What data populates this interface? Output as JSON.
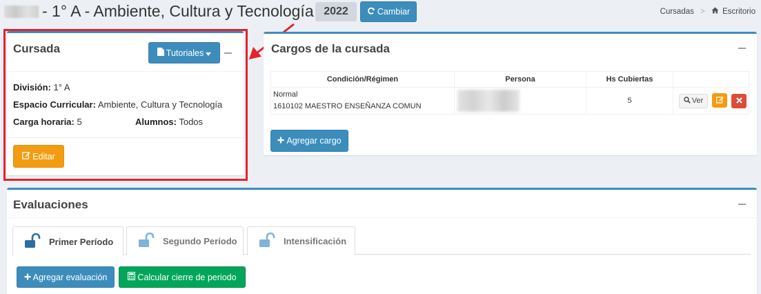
{
  "header": {
    "title": "- 1° A - Ambiente, Cultura y Tecnología -",
    "year": "2022",
    "cambiar_label": "Cambiar",
    "breadcrumb": {
      "item1": "Cursadas",
      "sep": ">",
      "item2": "Escritorio"
    }
  },
  "cursada": {
    "title": "Cursada",
    "tutoriales_label": "Tutoriales",
    "division_label": "División:",
    "division_value": "1° A",
    "espacio_label": "Espacio Curricular:",
    "espacio_value": "Ambiente, Cultura y Tecnología",
    "carga_label": "Carga horaria:",
    "carga_value": "5",
    "alumnos_label": "Alumnos:",
    "alumnos_value": "Todos",
    "editar_label": "Editar"
  },
  "cargos": {
    "title": "Cargos de la cursada",
    "columns": [
      "Condición/Régimen",
      "Persona",
      "Hs Cubiertas",
      ""
    ],
    "rows": [
      {
        "condicion": "Normal",
        "regimen": "1610102 MAESTRO ENSEÑANZA COMUN",
        "hs": "5",
        "ver_label": "Ver"
      }
    ],
    "agregar_label": "Agregar cargo"
  },
  "evaluaciones": {
    "title": "Evaluaciones",
    "tabs": [
      {
        "label": "Primer Período",
        "active": true
      },
      {
        "label": "Segundo Período",
        "active": false
      },
      {
        "label": "Intensificación",
        "active": false
      }
    ],
    "agregar_label": "Agregar evaluación",
    "calcular_label": "Calcular cierre de periodo"
  },
  "colors": {
    "primary": "#3c8dbc",
    "warning": "#f39c12",
    "danger": "#dd4b39",
    "success": "#00a65a",
    "highlight": "#e3222a"
  },
  "icons": [
    "refresh-icon",
    "home-icon",
    "file-icon",
    "caret-down-icon",
    "edit-icon",
    "search-icon",
    "times-icon",
    "plus-icon",
    "unlock-icon",
    "calculator-icon",
    "minus-icon"
  ]
}
